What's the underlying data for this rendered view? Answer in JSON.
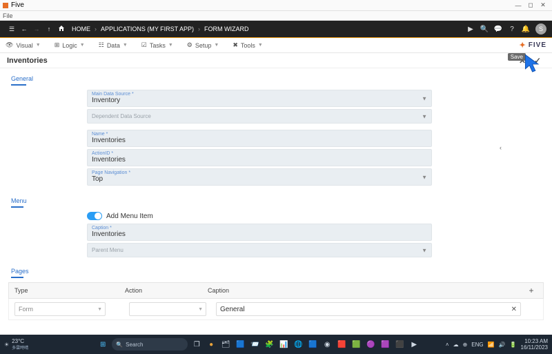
{
  "window": {
    "app_name": "Five",
    "menu_file": "File"
  },
  "breadcrumb": {
    "home": "HOME",
    "apps": "APPLICATIONS (MY FIRST APP)",
    "wizard": "FORM WIZARD",
    "avatar_initial": "S"
  },
  "toolbar": {
    "visual": "Visual",
    "logic": "Logic",
    "data": "Data",
    "tasks": "Tasks",
    "setup": "Setup",
    "tools": "Tools",
    "brand": "FIVE"
  },
  "panel": {
    "title": "Inventories",
    "save_tooltip": "Save"
  },
  "sections": {
    "general": "General",
    "menu": "Menu",
    "pages": "Pages"
  },
  "general": {
    "main_ds_label": "Main Data Source *",
    "main_ds_value": "Inventory",
    "dep_ds_label": "Dependent Data Source",
    "name_label": "Name *",
    "name_value": "Inventories",
    "actionid_label": "ActionID *",
    "actionid_value": "Inventories",
    "pagenav_label": "Page Navigation *",
    "pagenav_value": "Top"
  },
  "menu": {
    "toggle_label": "Add Menu Item",
    "caption_label": "Caption *",
    "caption_value": "Inventories",
    "parent_label": "Parent Menu"
  },
  "pages": {
    "col_type": "Type",
    "col_action": "Action",
    "col_caption": "Caption",
    "row0_type": "Form",
    "row0_caption": "General"
  },
  "taskbar": {
    "temp": "23°C",
    "weather_sub": "多雲時晴",
    "search": "Search",
    "lang": "ENG",
    "time": "10:23 AM",
    "date": "16/11/2023"
  }
}
